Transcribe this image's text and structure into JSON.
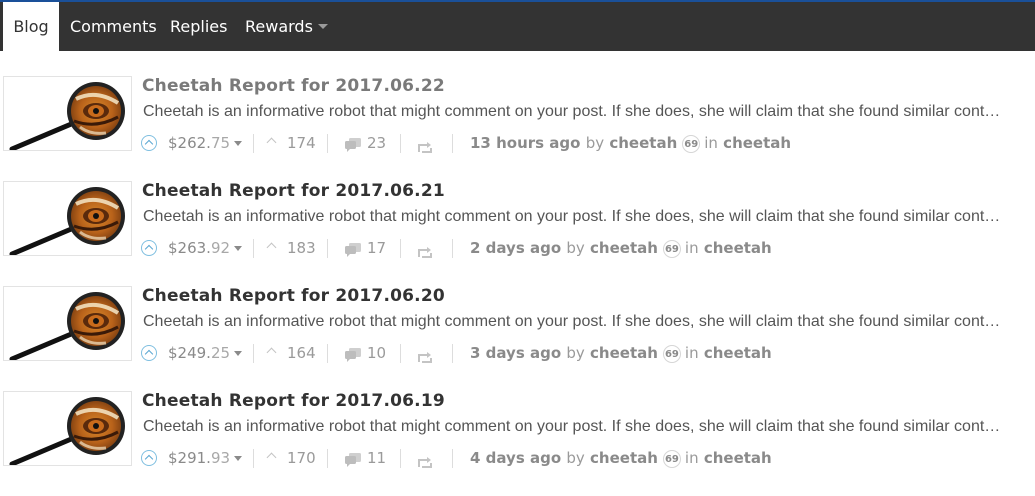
{
  "nav": {
    "tabs": [
      {
        "label": "Blog",
        "active": true
      },
      {
        "label": "Comments",
        "active": false
      },
      {
        "label": "Replies",
        "active": false
      },
      {
        "label": "Rewards",
        "active": false,
        "dropdown": true
      }
    ]
  },
  "posts": [
    {
      "title": "Cheetah Report for 2017.06.22",
      "summary": "Cheetah is an informative robot that might comment on your post. If she does, she will claim that she found similar content.",
      "payout_dollars": "$262.",
      "payout_cents": "75",
      "votes": "174",
      "comments": "23",
      "time": "13 hours ago",
      "by": "by",
      "author": "cheetah",
      "reputation": "69",
      "in": "in",
      "category": "cheetah"
    },
    {
      "title": "Cheetah Report for 2017.06.21",
      "summary": "Cheetah is an informative robot that might comment on your post. If she does, she will claim that she found similar content.",
      "payout_dollars": "$263.",
      "payout_cents": "92",
      "votes": "183",
      "comments": "17",
      "time": "2 days ago",
      "by": "by",
      "author": "cheetah",
      "reputation": "69",
      "in": "in",
      "category": "cheetah"
    },
    {
      "title": "Cheetah Report for 2017.06.20",
      "summary": "Cheetah is an informative robot that might comment on your post. If she does, she will claim that she found similar content.",
      "payout_dollars": "$249.",
      "payout_cents": "25",
      "votes": "164",
      "comments": "10",
      "time": "3 days ago",
      "by": "by",
      "author": "cheetah",
      "reputation": "69",
      "in": "in",
      "category": "cheetah"
    },
    {
      "title": "Cheetah Report for 2017.06.19",
      "summary": "Cheetah is an informative robot that might comment on your post. If she does, she will claim that she found similar content.",
      "payout_dollars": "$291.",
      "payout_cents": "93",
      "votes": "170",
      "comments": "11",
      "time": "4 days ago",
      "by": "by",
      "author": "cheetah",
      "reputation": "69",
      "in": "in",
      "category": "cheetah"
    }
  ],
  "icons": {
    "upvote": "upvote-circle-icon",
    "payout_menu": "caret-down-icon",
    "votes": "chevron-up-icon",
    "comments": "comment-bubbles-icon",
    "reblog": "reblog-icon",
    "thumbnail": "magnifier-cheetah-eye-icon"
  },
  "colors": {
    "navbar": "#333333",
    "accent_line": "#1a5099",
    "upvote": "#5aa7d2"
  }
}
